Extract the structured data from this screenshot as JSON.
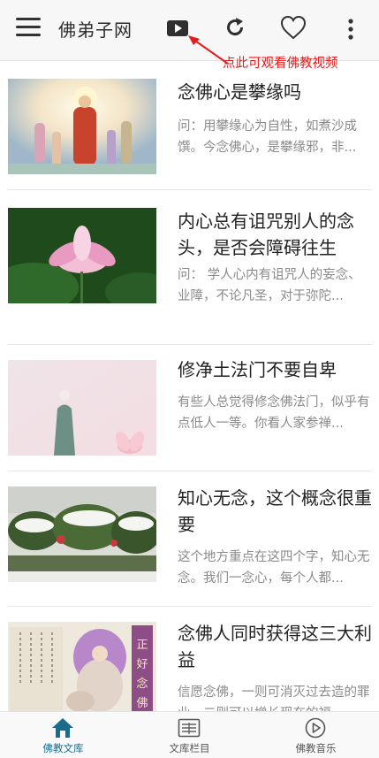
{
  "header": {
    "app_title": "佛弟子网",
    "annotation": "点此可观看佛教视频"
  },
  "articles": [
    {
      "title": "念佛心是攀缘吗",
      "summary": "问：用攀缘心为自性，如煮沙成馔。今念佛心，是攀缘邪，非..."
    },
    {
      "title": "内心总有诅咒别人的念头，是否会障碍往生",
      "summary": "问： 学人心内有诅咒人的妄念、业障，不论凡圣，对于弥陀..."
    },
    {
      "title": "修净土法门不要自卑",
      "summary": "有些人总觉得修念佛法门，似乎有点低人一等。你看人家参禅..."
    },
    {
      "title": "知心无念，这个概念很重要",
      "summary": "这个地方重点在这四个字，知心无念。我们一念心，每个人都..."
    },
    {
      "title": "念佛人同时获得这三大利益",
      "summary": "信愿念佛，一则可消灭过去造的罪业，二则可以增长现在的福..."
    }
  ],
  "thumbnail_art": {
    "calligraphy_short": "正好念佛"
  },
  "bottom_nav": {
    "items": [
      {
        "label": "佛教文库",
        "icon": "home-icon",
        "active": true
      },
      {
        "label": "文库栏目",
        "icon": "list-icon",
        "active": false
      },
      {
        "label": "佛教音乐",
        "icon": "play-circle-icon",
        "active": false
      }
    ]
  },
  "colors": {
    "accent": "#1a6b8c",
    "annotation": "#e51c1c",
    "summary_text": "#8a8a8a"
  }
}
